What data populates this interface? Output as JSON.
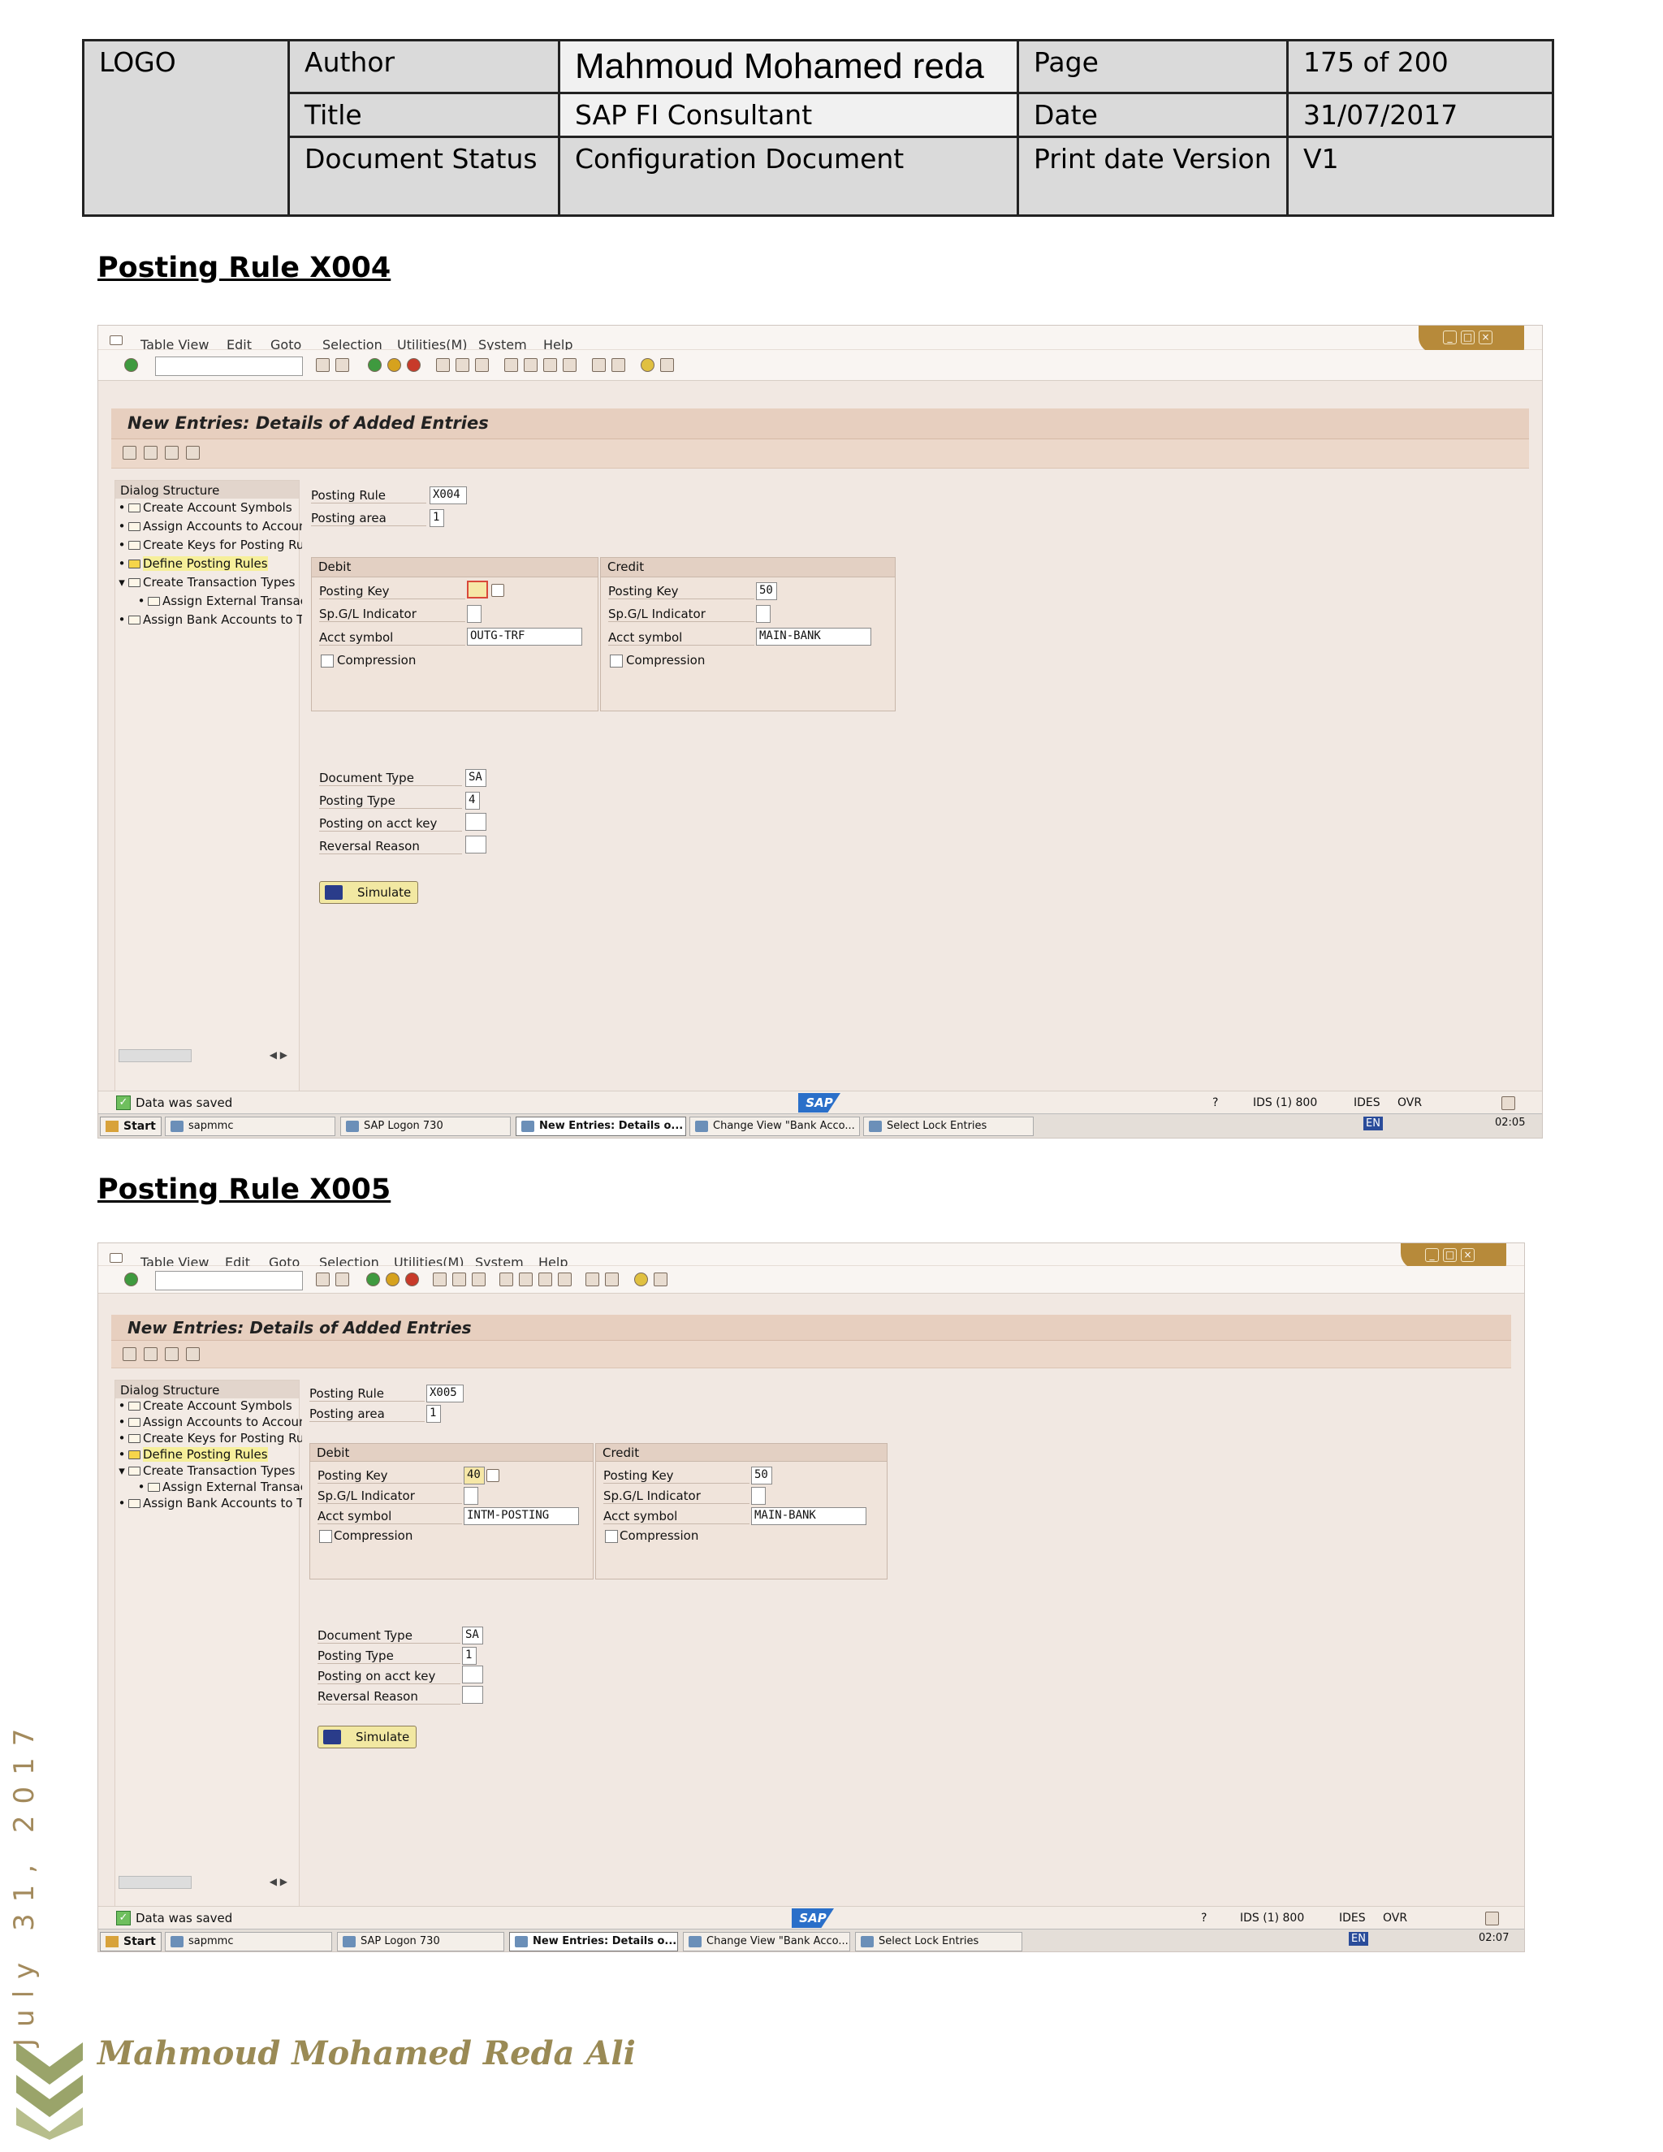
{
  "header": {
    "logo": "LOGO",
    "author_label": "Author",
    "author_value": "Mahmoud Mohamed reda",
    "page_label": "Page",
    "page_value": "175 of 200",
    "title_label": "Title",
    "title_value": "SAP FI Consultant",
    "date_label": "Date",
    "date_value": "31/07/2017",
    "status_label": "Document Status",
    "status_value": "Configuration Document",
    "version_label": "Print date Version",
    "version_value": "V1"
  },
  "sap": {
    "menu": [
      "Table View",
      "Edit",
      "Goto",
      "Selection",
      "Utilities(M)",
      "System",
      "Help"
    ],
    "title": "New Entries: Details of Added Entries",
    "tree_header": "Dialog Structure",
    "tree": [
      {
        "label": "Create Account Symbols",
        "bullet": "•",
        "indent": 0,
        "highlight": false
      },
      {
        "label": "Assign Accounts to Account Symbol",
        "bullet": "•",
        "indent": 0,
        "highlight": false
      },
      {
        "label": "Create Keys for Posting Rules",
        "bullet": "•",
        "indent": 0,
        "highlight": false
      },
      {
        "label": "Define Posting Rules",
        "bullet": "•",
        "indent": 0,
        "highlight": true
      },
      {
        "label": "Create Transaction Types",
        "bullet": "▾",
        "indent": 0,
        "highlight": false
      },
      {
        "label": "Assign External Transaction Types",
        "bullet": "•",
        "indent": 1,
        "highlight": false
      },
      {
        "label": "Assign Bank Accounts to Transaction Types",
        "bullet": "•",
        "indent": 0,
        "highlight": false
      }
    ],
    "labels": {
      "posting_rule": "Posting Rule",
      "posting_area": "Posting area",
      "debit": "Debit",
      "credit": "Credit",
      "posting_key": "Posting Key",
      "spgl": "Sp.G/L Indicator",
      "acct_symbol": "Acct symbol",
      "compression": "Compression",
      "document_type": "Document Type",
      "posting_type": "Posting Type",
      "posting_on_acct_key": "Posting on acct key",
      "reversal_reason": "Reversal Reason",
      "simulate": "Simulate"
    },
    "status_message": "Data was saved",
    "sap_logo": "SAP",
    "system": "IDS (1) 800",
    "server": "IDES",
    "mode": "OVR",
    "taskbar": {
      "start": "Start",
      "tasks": [
        "sapmmc",
        "SAP Logon 730",
        "New Entries: Details o...",
        "Change View \"Bank Acco...",
        "Select Lock Entries"
      ],
      "lang": "EN"
    }
  },
  "sections": [
    {
      "heading": "Posting Rule X004",
      "posting_rule": "X004",
      "posting_area": "1",
      "debit_posting_key": "",
      "debit_spgl": "",
      "debit_acct_symbol": "OUTG-TRF",
      "credit_posting_key": "50",
      "credit_spgl": "",
      "credit_acct_symbol": "MAIN-BANK",
      "document_type": "SA",
      "posting_type": "4",
      "posting_on_acct_key": "",
      "reversal_reason": "",
      "clock": "02:05"
    },
    {
      "heading": "Posting Rule X005",
      "posting_rule": "X005",
      "posting_area": "1",
      "debit_posting_key": "40",
      "debit_spgl": "",
      "debit_acct_symbol": "INTM-POSTING",
      "credit_posting_key": "50",
      "credit_spgl": "",
      "credit_acct_symbol": "MAIN-BANK",
      "document_type": "SA",
      "posting_type": "1",
      "posting_on_acct_key": "",
      "reversal_reason": "",
      "clock": "02:07"
    }
  ],
  "footer": {
    "date": "July 31, 2017",
    "signature": "Mahmoud Mohamed Reda Ali"
  }
}
